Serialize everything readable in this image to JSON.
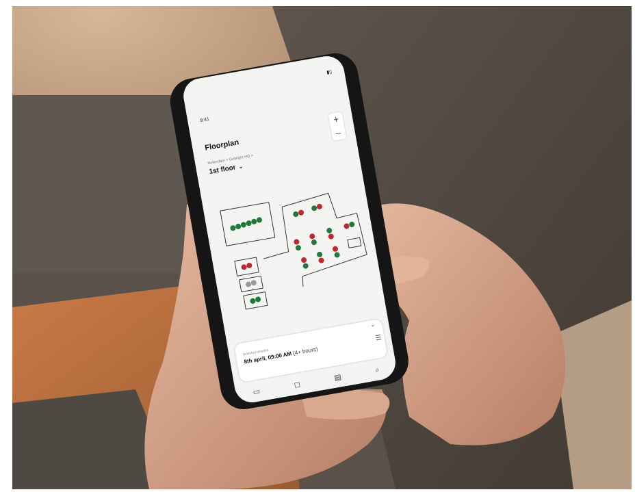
{
  "screen": {
    "status_time": "9:41",
    "app_title": "Floorplan",
    "breadcrumb": "Rotterdam  >  Gebright HQ  >",
    "floor_label": "1st floor",
    "zoom_in": "+",
    "zoom_out": "–",
    "selected_label": "Selected timeslot",
    "selected_date": "8th april, 09:00 AM",
    "selected_duration": "(4+ hours)",
    "tabs": [
      "calendar-icon",
      "check-icon",
      "map-icon",
      "search-icon"
    ]
  },
  "colors": {
    "desk_available": "#1f7a3a",
    "desk_occupied": "#c0262d",
    "desk_unavailable": "#9a9a9a",
    "screen_bg": "#f4f4f2"
  }
}
